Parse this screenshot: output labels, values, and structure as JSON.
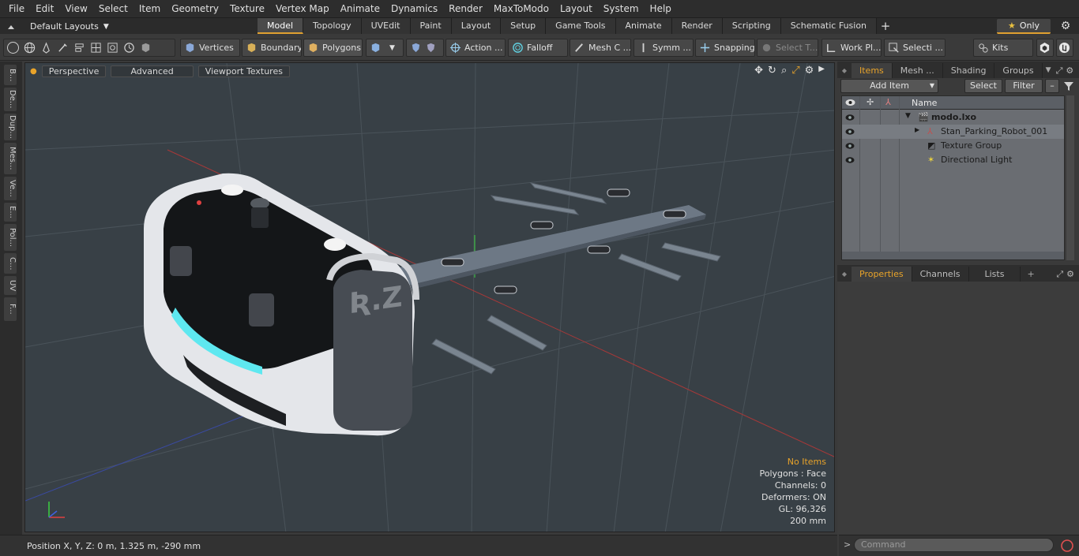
{
  "menubar": {
    "items": [
      "File",
      "Edit",
      "View",
      "Select",
      "Item",
      "Geometry",
      "Texture",
      "Vertex Map",
      "Animate",
      "Dynamics",
      "Render",
      "MaxToModo",
      "Layout",
      "System",
      "Help"
    ]
  },
  "tabbar": {
    "layout_label": "Default Layouts",
    "tabs": [
      "Model",
      "Topology",
      "UVEdit",
      "Paint",
      "Layout",
      "Setup",
      "Game Tools",
      "Animate",
      "Render",
      "Scripting",
      "Schematic Fusion"
    ],
    "active_tab": "Model",
    "only_label": "Only"
  },
  "toolbar": {
    "vertices": "Vertices",
    "boundary": "Boundary",
    "polygons": "Polygons",
    "action": "Action ...",
    "falloff": "Falloff",
    "mesh": "Mesh C ...",
    "symm": "Symm ...",
    "snapping": "Snapping",
    "select_t": "Select T...",
    "work_pl": "Work Pl...",
    "selecti": "Selecti ...",
    "kits": "Kits"
  },
  "left_tabs": [
    "B...",
    "De...",
    "Dup...",
    "Mes...",
    "Ve...",
    "E...",
    "Pol...",
    "C...",
    "UV",
    "F..."
  ],
  "viewport": {
    "perspective": "Perspective",
    "advanced": "Advanced",
    "textures": "Viewport Textures",
    "info": {
      "no_items": "No Items",
      "polygons": "Polygons : Face",
      "channels": "Channels: 0",
      "deformers": "Deformers: ON",
      "gl": "GL: 96,326",
      "scale": "200 mm"
    },
    "robot_label": "Ʀ.Z"
  },
  "statusbar": {
    "position": "Position X, Y, Z:   0 m, 1.325 m, -290 mm"
  },
  "items_panel": {
    "tabs": [
      "Items",
      "Mesh ...",
      "Shading",
      "Groups"
    ],
    "active_tab": "Items",
    "add_item": "Add Item",
    "select": "Select",
    "filter": "Filter",
    "name_header": "Name",
    "rows": [
      "modo.lxo",
      "Stan_Parking_Robot_001",
      "Texture Group",
      "Directional Light"
    ]
  },
  "properties_panel": {
    "tabs": [
      "Properties",
      "Channels",
      "Lists"
    ],
    "active_tab": "Properties"
  },
  "command": {
    "placeholder": "Command"
  },
  "colors": {
    "accent": "#e8a32a",
    "viewport_bg": "#384046"
  }
}
